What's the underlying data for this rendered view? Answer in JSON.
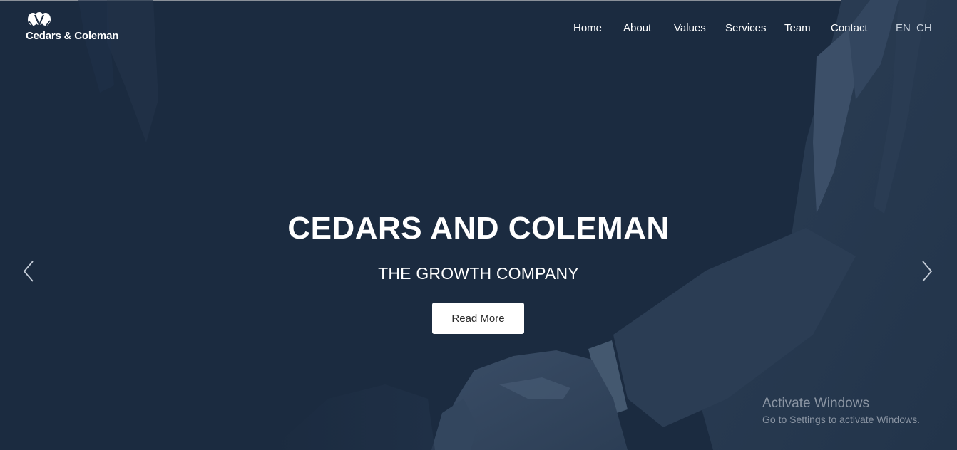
{
  "brand": {
    "name": "Cedars & Coleman",
    "logo_icon": "overlapping-leaf-mark-icon"
  },
  "nav": {
    "items": [
      {
        "label": "Home"
      },
      {
        "label": "About"
      },
      {
        "label": "Values"
      },
      {
        "label": "Services"
      },
      {
        "label": "Team"
      },
      {
        "label": "Contact"
      }
    ],
    "languages": [
      {
        "label": "EN"
      },
      {
        "label": "CH"
      }
    ]
  },
  "hero": {
    "title": "CEDARS AND COLEMAN",
    "subtitle": "THE GROWTH COMPANY",
    "cta_label": "Read More",
    "prev_icon": "chevron-left-icon",
    "next_icon": "chevron-right-icon",
    "background_image": "handshake-photo"
  },
  "os_watermark": {
    "title": "Activate Windows",
    "subtitle": "Go to Settings to activate Windows."
  },
  "colors": {
    "background": "#1b2b40",
    "text": "#ffffff",
    "button_bg": "#ffffff",
    "button_text": "#2a2a2a",
    "watermark": "#8b95a3"
  }
}
